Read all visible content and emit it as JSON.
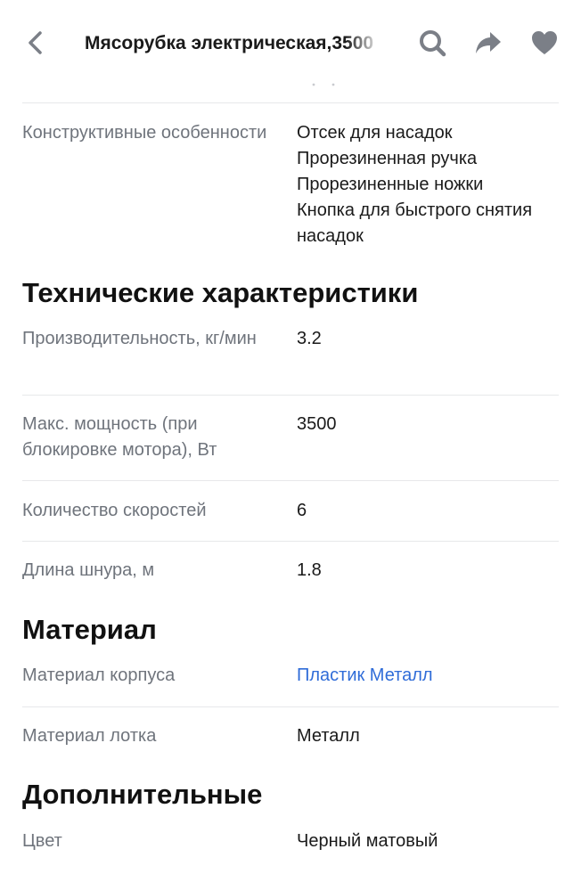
{
  "header": {
    "title": "Мясорубка электрическая,3500",
    "back_icon": "chevron-left-icon",
    "actions": [
      "search-icon",
      "share-icon",
      "heart-icon"
    ]
  },
  "colors": {
    "label": "#6f747c",
    "value": "#1a1a1a",
    "link": "#2f6cd8",
    "icon": "#7b7f87",
    "divider": "#e7e8ea"
  },
  "features": {
    "label": "Конструктивные особенности",
    "values": [
      "Отсек для насадок",
      "Прорезиненная ручка",
      "Прорезиненные ножки",
      "Кнопка для быстрого снятия насадок"
    ]
  },
  "tech": {
    "title": "Технические характеристики",
    "rows": [
      {
        "label": "Производительность, кг/мин",
        "value": "3.2"
      },
      {
        "label": "Макс. мощность (при блокировке мотора), Вт",
        "value": "3500"
      },
      {
        "label": "Количество скоростей",
        "value": "6"
      },
      {
        "label": "Длина шнура, м",
        "value": "1.8"
      }
    ]
  },
  "material": {
    "title": "Материал",
    "rows": [
      {
        "label": "Материал корпуса",
        "value": "Пластик Металл"
      },
      {
        "label": "Материал лотка",
        "value": "Металл"
      }
    ]
  },
  "extra": {
    "title": "Дополнительные",
    "rows": [
      {
        "label": "Цвет",
        "value": "Черный матовый"
      }
    ]
  }
}
